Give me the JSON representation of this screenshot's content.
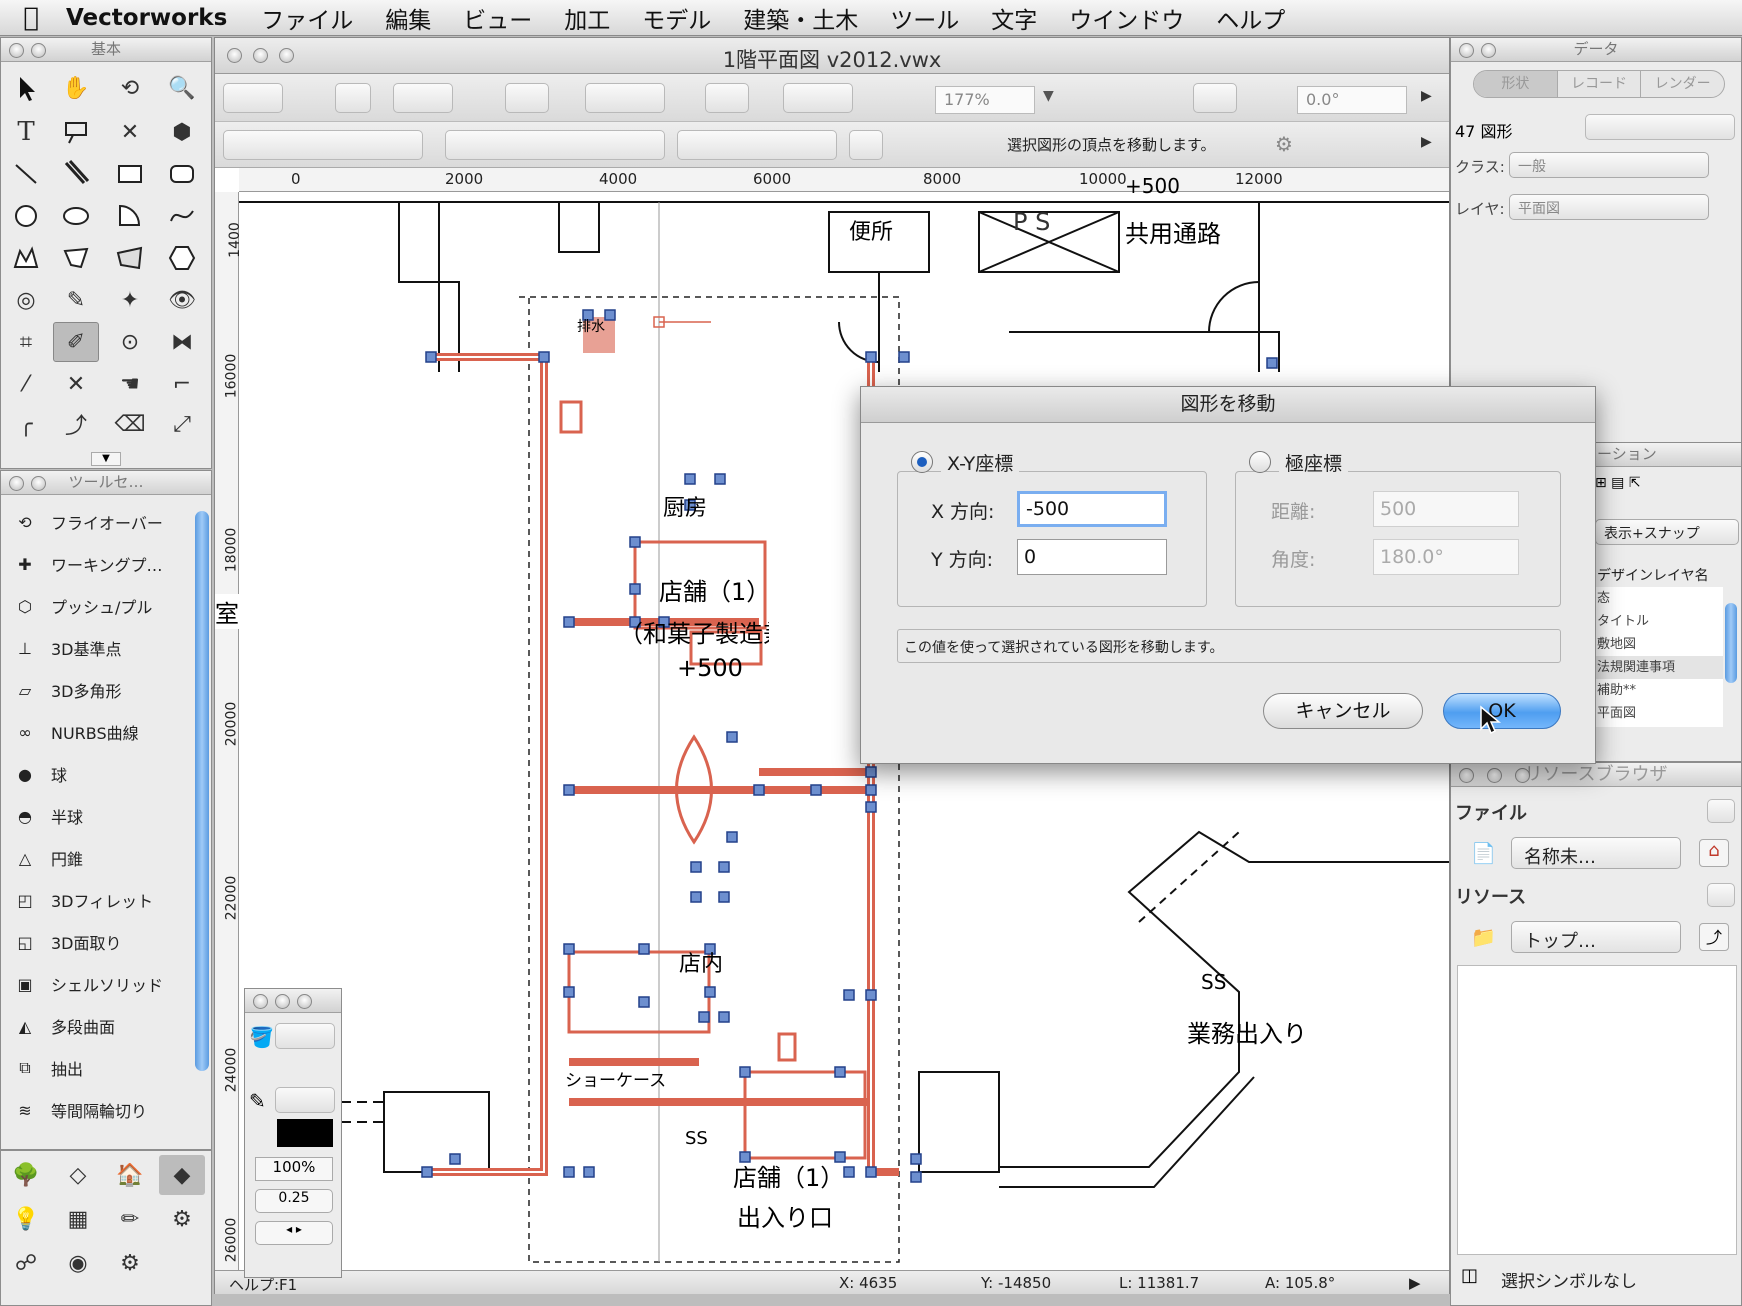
{
  "menubar": {
    "app_name": "Vectorworks",
    "items": [
      "ファイル",
      "編集",
      "ビュー",
      "加工",
      "モデル",
      "建築・土木",
      "ツール",
      "文字",
      "ウインドウ",
      "ヘルプ"
    ]
  },
  "basic_palette": {
    "title": "基本"
  },
  "toolset_palette": {
    "title": "ツールセ…",
    "items": [
      "フライオーバー",
      "ワーキングプ…",
      "プッシュ/プル",
      "3D基準点",
      "3D多角形",
      "NURBS曲線",
      "球",
      "半球",
      "円錐",
      "3Dフィレット",
      "3D面取り",
      "シェルソリッド",
      "多段曲面",
      "抽出",
      "等間隔輪切り"
    ]
  },
  "attr_palette": {
    "opacity": "100%",
    "line_weight": "0.25"
  },
  "document": {
    "title": "1階平面図 v2012.vwx",
    "zoom": "177%",
    "angle": "0.0°",
    "mode_hint": "選択図形の頂点を移動します。",
    "ruler_h": [
      "0",
      "2000",
      "4000",
      "6000",
      "8000",
      "10000",
      "12000"
    ],
    "ruler_v": [
      "1400",
      "16000",
      "18000",
      "20000",
      "22000",
      "24000",
      "26000"
    ],
    "labels": {
      "toilet": "便所",
      "ps": "P S",
      "corridor": "共用通路",
      "plus500_top": "+500",
      "kitchen": "厨房",
      "store1": "店舗（1）",
      "store1_sub": "（和菓子製造兼",
      "plus500": "+500",
      "room_left": "室",
      "store_inside": "店内",
      "showcase": "ショーケース",
      "ss1": "SS",
      "ss2": "SS",
      "service_entry": "業務出入り",
      "entrance1": "店舗（1）",
      "entrance2": "出入り口",
      "drain": "排水"
    }
  },
  "statusbar": {
    "help": "ヘルプ:F1",
    "x": "X:  4635",
    "y": "Y:  -14850",
    "l": "L:  11381.7",
    "a": "A:  105.8°"
  },
  "data_palette": {
    "title": "データ",
    "tabs": [
      "形状",
      "レコード",
      "レンダー"
    ],
    "count": "47 図形",
    "class_label": "クラス:",
    "class_value": "一般",
    "layer_label": "レイヤ:",
    "layer_value": "平面図"
  },
  "navigation_palette": {
    "title": "ーション",
    "mode": "表示+スナップ",
    "header": "デザインレイヤ名",
    "layers": [
      "态",
      "タイトル",
      "敷地図",
      "法規関連事項",
      "補助**",
      "平面図"
    ]
  },
  "resource_browser": {
    "title": "リソースブラウザ",
    "file_label": "ファイル",
    "file_value": "名称未…",
    "resource_label": "リソース",
    "resource_value": "トップ…",
    "symbol": "選択シンボルなし"
  },
  "dialog": {
    "title": "図形を移動",
    "xy_option": "X-Y座標",
    "polar_option": "極座標",
    "x_label": "X 方向:",
    "x_value": "-500",
    "y_label": "Y 方向:",
    "y_value": "0",
    "dist_label": "距離:",
    "dist_value": "500",
    "angle_label": "角度:",
    "angle_value": "180.0°",
    "message": "この値を使って選択されている図形を移動します。",
    "cancel": "キャンセル",
    "ok": "OK"
  },
  "colors": {
    "selection": "#d9634f",
    "handle": "#6d8fcf",
    "ok_button": "#4f9ef0"
  }
}
